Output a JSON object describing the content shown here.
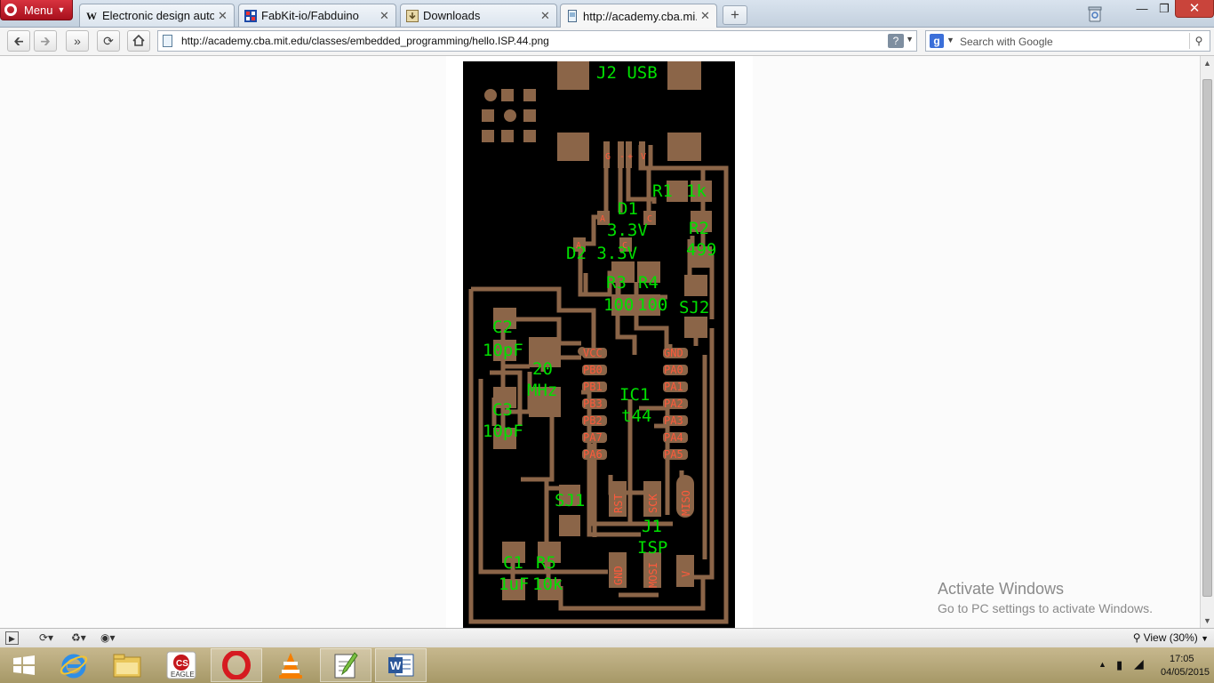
{
  "browser": {
    "menu_label": "Menu",
    "tabs": [
      {
        "title": "Electronic design auto...",
        "favicon": "W",
        "active": false
      },
      {
        "title": "FabKit-io/Fabduino",
        "favicon": "grid",
        "active": false
      },
      {
        "title": "Downloads",
        "favicon": "download",
        "active": false
      },
      {
        "title": "http://academy.cba.mi...",
        "favicon": "page",
        "active": true
      }
    ],
    "new_tab_label": "+",
    "address_url": "http://academy.cba.mit.edu/classes/embedded_programming/hello.ISP.44.png",
    "search_placeholder": "Search with Google",
    "search_engine": "Google",
    "zoom_label": "View (30%)"
  },
  "board": {
    "labels": {
      "j2": "J2 USB",
      "usb_g": "G",
      "usb_minus": "-",
      "usb_plus": "+",
      "usb_v": "V",
      "r1": "R1",
      "r1_val": "1k",
      "d1": "D1",
      "d1_val": "3.3V",
      "d1_a": "A",
      "d1_c": "C",
      "d2_a": "A",
      "d2_c": "C",
      "d2": "D2 3.3V",
      "r2": "R2",
      "r2_val": "499",
      "r3": "R3",
      "r3_val": "100",
      "r4": "R4",
      "r4_val": "100",
      "sj2": "SJ2",
      "c2": "C2",
      "c2_val": "10pF",
      "xtal": "20",
      "xtal_unit": "MHz",
      "c3": "C3",
      "c3_val": "10pF",
      "ic1": "IC1",
      "ic1_val": "t44",
      "sj1": "SJ1",
      "j1": "J1",
      "j1_val": "ISP",
      "c1": "C1",
      "c1_val": "1uF",
      "r5": "R5",
      "r5_val": "10k"
    },
    "pins_left": [
      "VCC",
      "PB0",
      "PB1",
      "PB3",
      "PB2",
      "PA7",
      "PA6"
    ],
    "pins_right": [
      "GND",
      "PA0",
      "PA1",
      "PA2",
      "PA3",
      "PA4",
      "PA5"
    ],
    "isp_pins": [
      "RST",
      "SCK",
      "MISO",
      "GND",
      "MOSI",
      "V"
    ],
    "colors": {
      "background": "#000000",
      "copper": "#8b6548",
      "silk": "#00e000",
      "pin_text": "#ff5a3c"
    }
  },
  "watermark": {
    "title": "Activate Windows",
    "subtitle": "Go to PC settings to activate Windows."
  },
  "taskbar": {
    "apps": [
      "internet-explorer",
      "file-explorer",
      "eagle",
      "opera",
      "vlc",
      "notepad-plus",
      "word"
    ],
    "eagle_label": "EAGLE",
    "time": "17:05",
    "date": "04/05/2015"
  }
}
